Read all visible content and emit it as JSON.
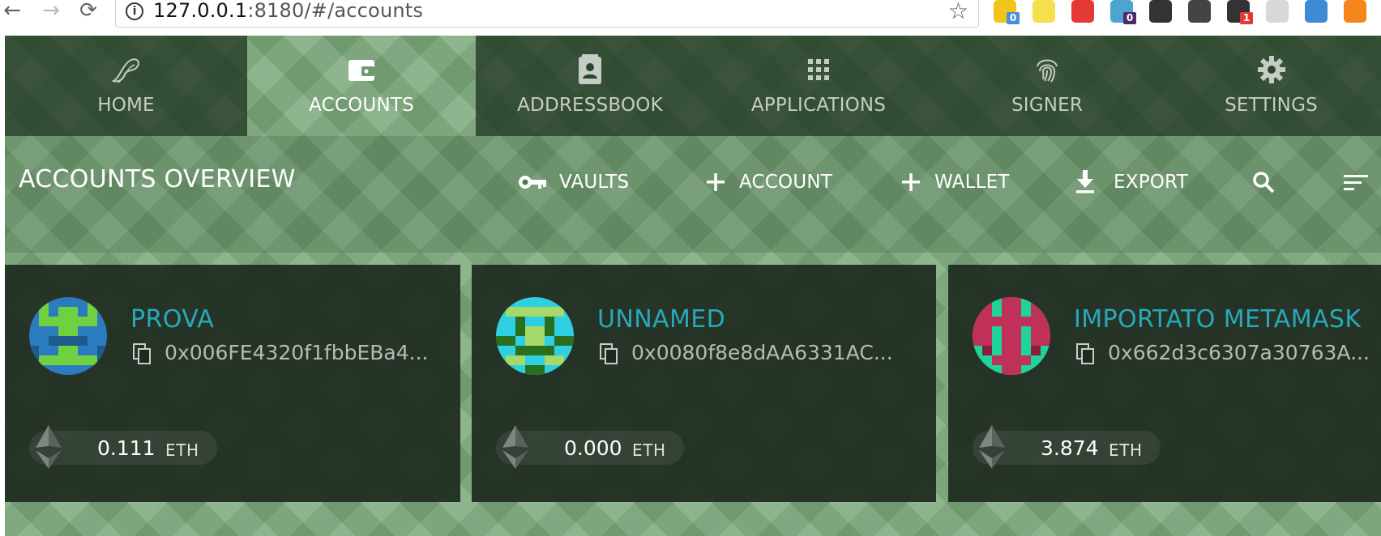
{
  "browser": {
    "url_host": "127.0.0.1",
    "url_rest": ":8180/#/accounts",
    "extensions": [
      {
        "icon": "folder-extension-icon",
        "badge": "0",
        "color": "#f0c419",
        "badge_color": "#4a90d9"
      },
      {
        "icon": "n-extension-icon",
        "badge": "",
        "color": "#f4e04d",
        "badge_color": ""
      },
      {
        "icon": "adblock-extension-icon",
        "badge": "",
        "color": "#e53935",
        "badge_color": ""
      },
      {
        "icon": "ghostery-extension-icon",
        "badge": "0",
        "color": "#4fa3d1",
        "badge_color": "#4a2c6d"
      },
      {
        "icon": "slash-extension-icon",
        "badge": "",
        "color": "#333333",
        "badge_color": ""
      },
      {
        "icon": "link-extension-icon",
        "badge": "",
        "color": "#444444",
        "badge_color": ""
      },
      {
        "icon": "chat-extension-icon",
        "badge": "1",
        "color": "#333333",
        "badge_color": "#e53935"
      },
      {
        "icon": "id-extension-icon",
        "badge": "",
        "color": "#d8d8d8",
        "badge_color": ""
      },
      {
        "icon": "octopus-extension-icon",
        "badge": "",
        "color": "#3d8bd4",
        "badge_color": ""
      },
      {
        "icon": "metamask-extension-icon",
        "badge": "",
        "color": "#f6851b",
        "badge_color": ""
      }
    ]
  },
  "nav": {
    "tabs": [
      {
        "label": "HOME",
        "icon": "parity-logo-icon",
        "active": false
      },
      {
        "label": "ACCOUNTS",
        "icon": "wallet-icon",
        "active": true
      },
      {
        "label": "ADDRESSBOOK",
        "icon": "contact-card-icon",
        "active": false
      },
      {
        "label": "APPLICATIONS",
        "icon": "apps-grid-icon",
        "active": false
      },
      {
        "label": "SIGNER",
        "icon": "fingerprint-icon",
        "active": false
      },
      {
        "label": "SETTINGS",
        "icon": "gear-icon",
        "active": false
      }
    ]
  },
  "toolbar": {
    "title": "ACCOUNTS OVERVIEW",
    "buttons": [
      {
        "label": "VAULTS",
        "icon": "key-icon"
      },
      {
        "label": "ACCOUNT",
        "icon": "plus-icon"
      },
      {
        "label": "WALLET",
        "icon": "plus-icon"
      },
      {
        "label": "EXPORT",
        "icon": "download-icon"
      }
    ],
    "search_icon": "search-icon",
    "sort_icon": "sort-icon"
  },
  "accounts": [
    {
      "name": "PROVA",
      "address": "0x006FE4320f1fbbEBa4...",
      "balance": "0.111",
      "unit": "ETH",
      "identicon_colors": [
        "#2b7bbf",
        "#6fd13f",
        "#1d5b8f"
      ]
    },
    {
      "name": "UNNAMED",
      "address": "0x0080f8e8dAA6331AC...",
      "balance": "0.000",
      "unit": "ETH",
      "identicon_colors": [
        "#2ecfe0",
        "#a6d86a",
        "#2a6f1f"
      ]
    },
    {
      "name": "IMPORTATO METAMASK",
      "address": "0x662d3c6307a30763A...",
      "balance": "3.874",
      "unit": "ETH",
      "identicon_colors": [
        "#1fd39a",
        "#c0315a",
        "#8a1f3c"
      ]
    }
  ],
  "colors": {
    "accent": "#29a9b8",
    "background": "#7daa7c",
    "tab_bg": "#1c301e",
    "card_bg": "#1e2a20"
  }
}
